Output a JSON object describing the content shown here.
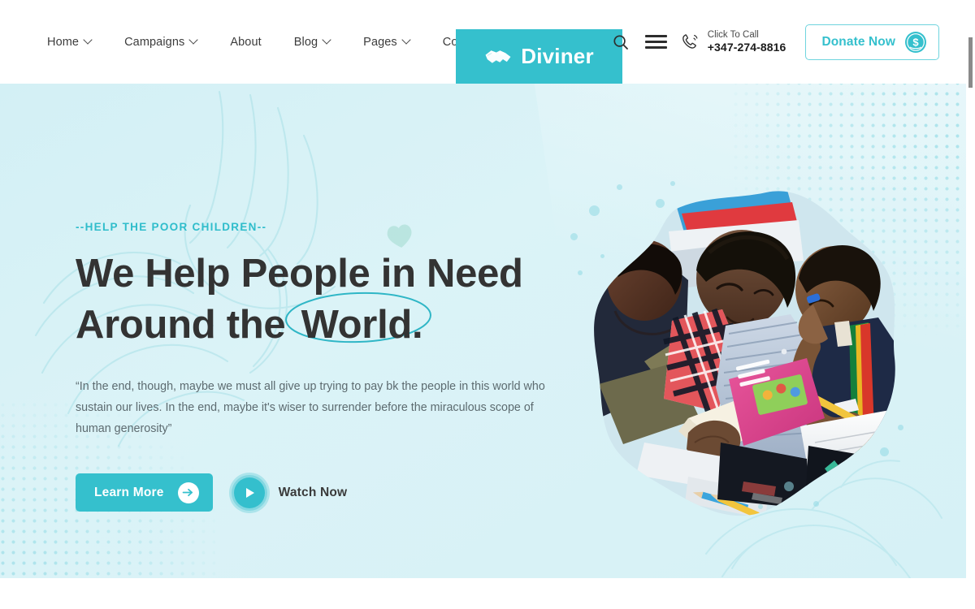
{
  "header": {
    "nav_items": [
      {
        "label": "Home",
        "has_dropdown": true,
        "icon": "chevron-down-icon"
      },
      {
        "label": "Campaigns",
        "has_dropdown": true,
        "icon": "chevron-down-icon"
      },
      {
        "label": "About",
        "has_dropdown": false,
        "icon": ""
      },
      {
        "label": "Blog",
        "has_dropdown": true,
        "icon": "chevron-down-icon"
      },
      {
        "label": "Pages",
        "has_dropdown": true,
        "icon": "chevron-down-icon"
      },
      {
        "label": "Contact",
        "has_dropdown": false,
        "icon": ""
      }
    ],
    "logo": {
      "text": "Diviner",
      "icon": "handshake-icon",
      "bg_color": "#35c0cd"
    },
    "search_icon": "search-icon",
    "menu_icon": "hamburger-menu-icon",
    "call": {
      "icon": "phone-ring-icon",
      "label": "Click To Call",
      "number": "+347-274-8816"
    },
    "donate": {
      "label": "Donate Now",
      "icon": "dollar-coin-icon",
      "color": "#35c0cd"
    }
  },
  "hero": {
    "eyebrow": "--HELP THE POOR CHILDREN--",
    "title_line1": "We Help People in Need",
    "title_line2_pre": "Around the ",
    "title_line2_highlight": "World.",
    "description": "“In the end, though, maybe we must all give up trying to pay bk the people in this world who sustain our lives. In the end, maybe it's wiser to surrender before the miraculous scope of human generosity”",
    "primary_cta": {
      "label": "Learn More",
      "icon": "arrow-right-circle-icon"
    },
    "secondary_cta": {
      "label": "Watch Now",
      "icon": "play-circle-icon"
    },
    "background_color": "#d6f1f5",
    "accent_color": "#35c0cd",
    "heading_color": "#333333",
    "decorations": [
      "halftone-dots-top-right",
      "halftone-dots-bottom-left",
      "line-art-hands",
      "heart-shape",
      "bubble-dots"
    ],
    "image": {
      "name": "children-reading-books-photo",
      "alt": "Three children sitting together reading books and writing",
      "mask": "brush-stroke"
    }
  },
  "scrollbar": {
    "name": "page-scrollbar",
    "position": "right"
  }
}
